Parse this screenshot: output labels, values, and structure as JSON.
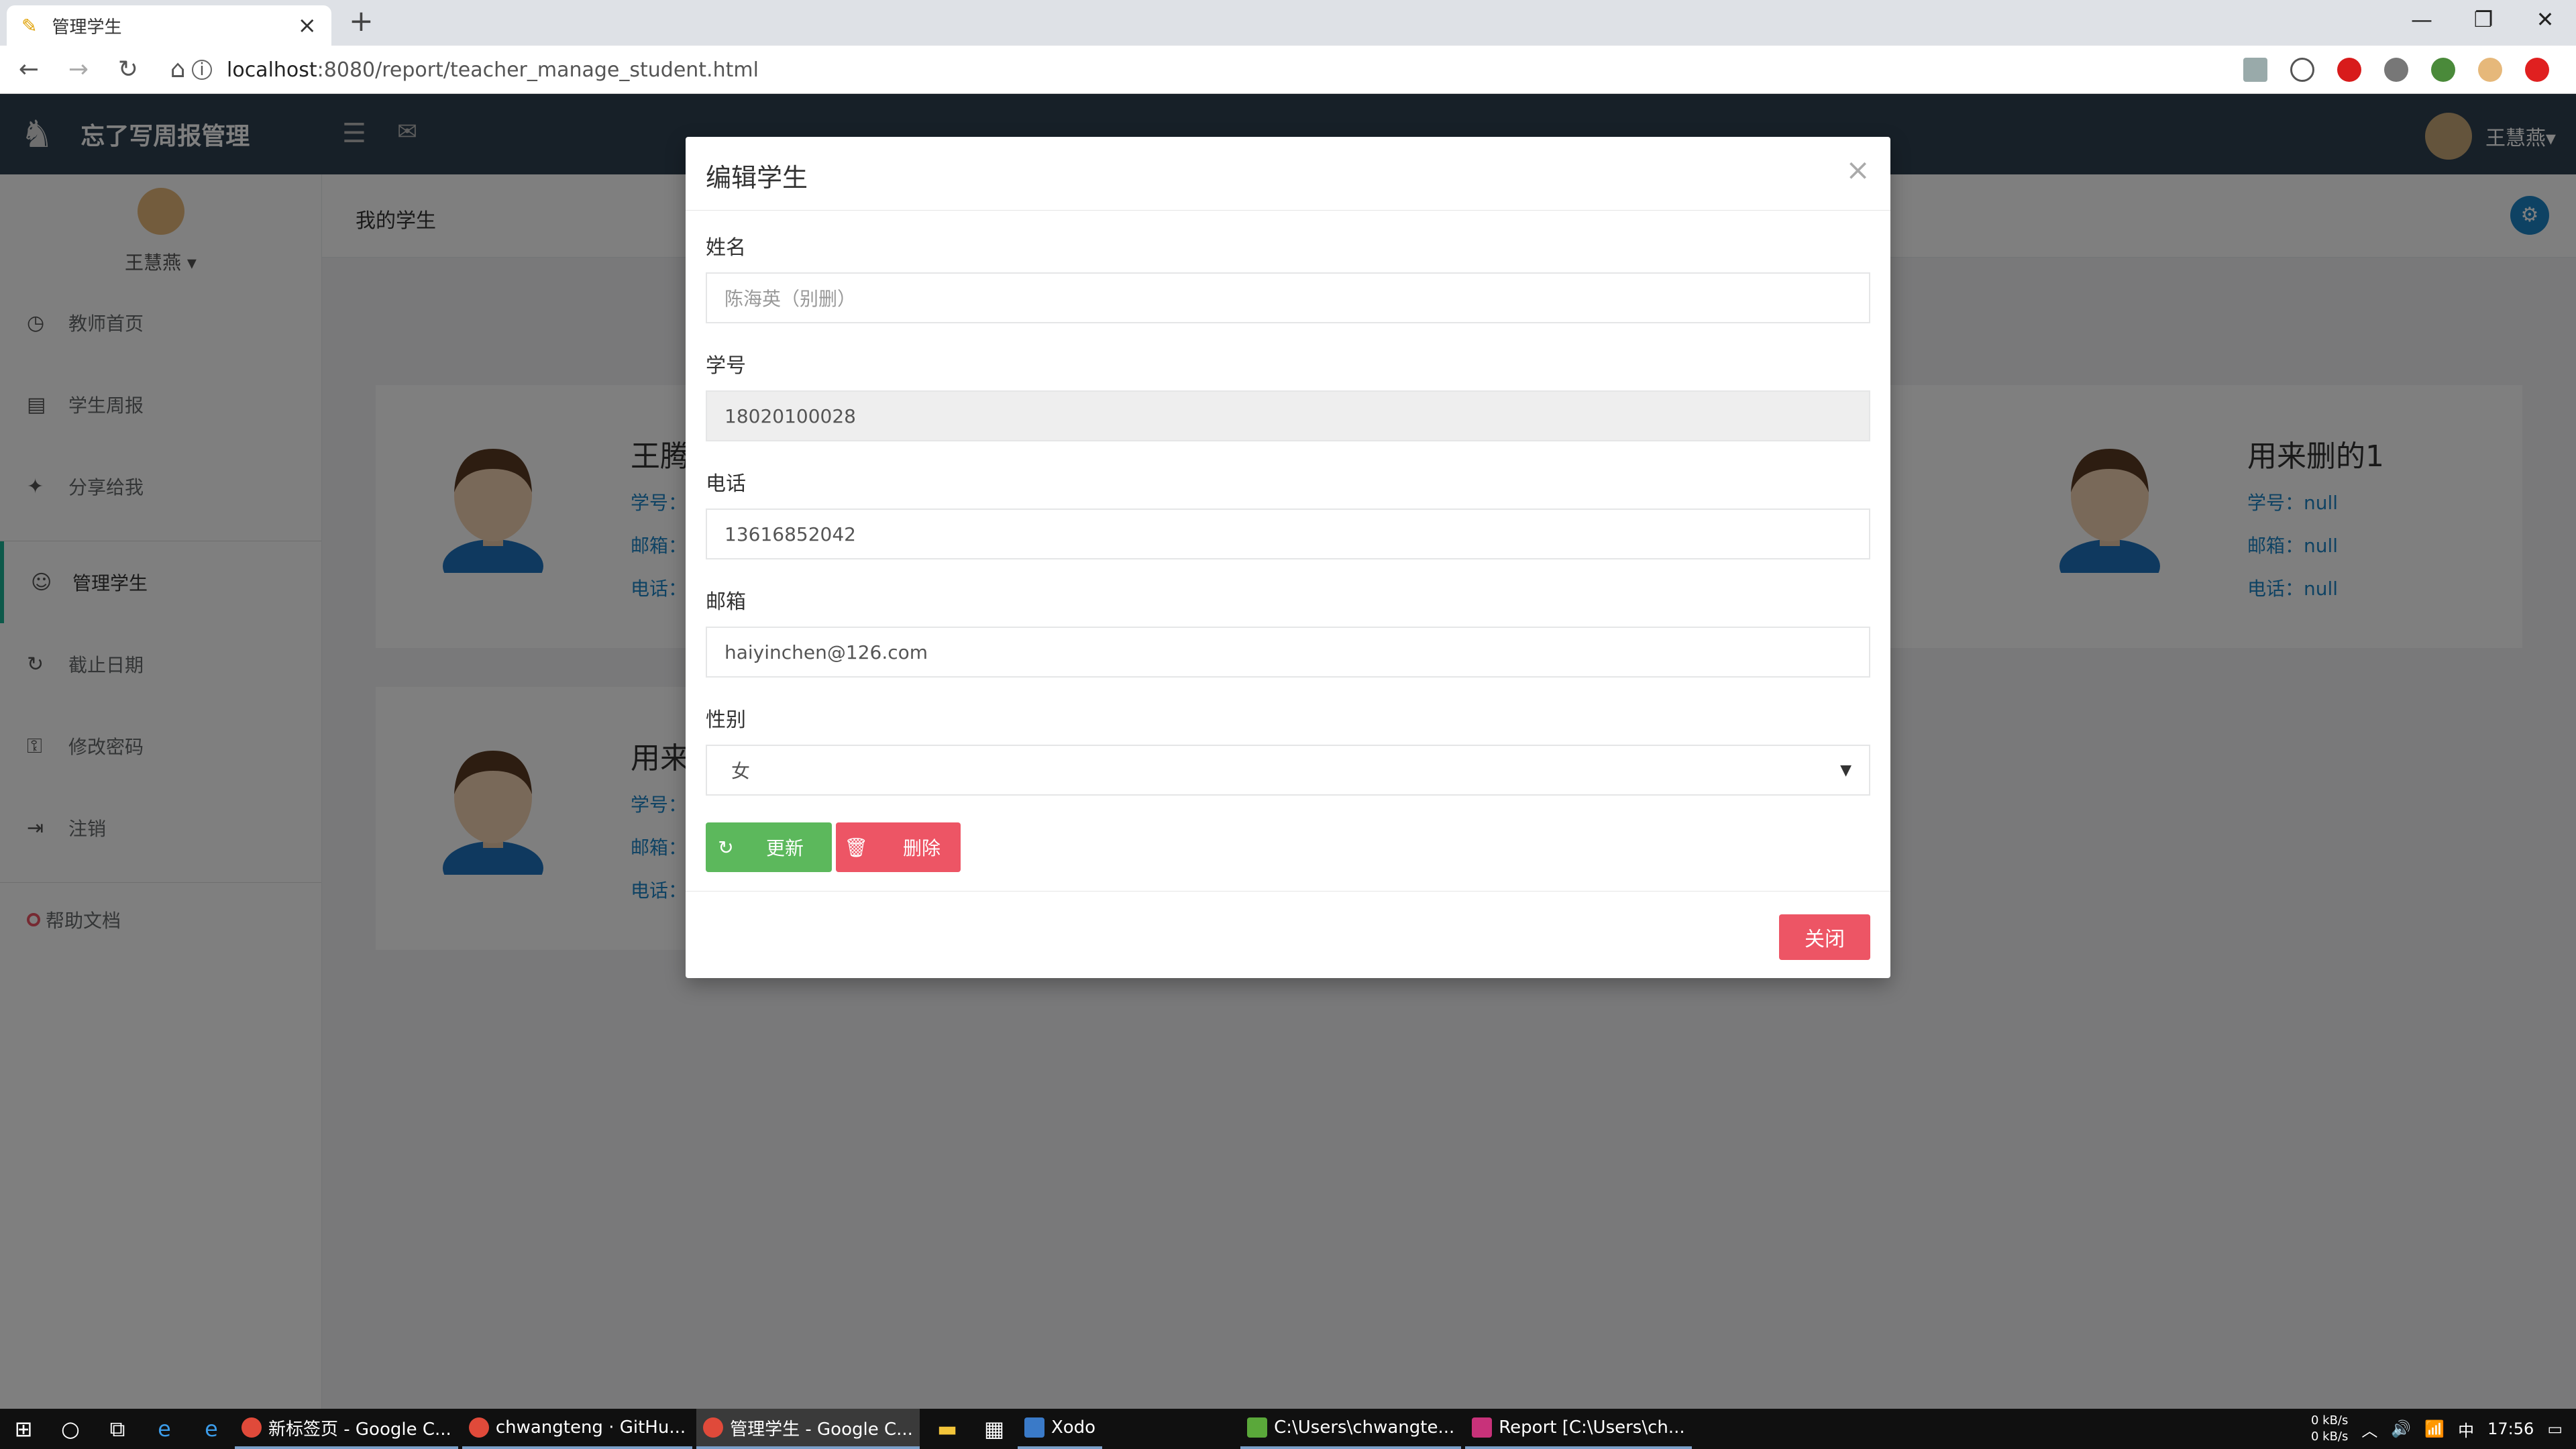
{
  "browser": {
    "tab_title": "管理学生",
    "tab_close": "×",
    "new_tab": "+",
    "url_host": "localhost",
    "url_path": ":8080/report/teacher_manage_student.html",
    "win_min": "—",
    "win_max": "❐",
    "win_close": "✕"
  },
  "app": {
    "brand": "忘了写周报管理",
    "user_name": "王慧燕",
    "top_user": "王慧燕▾",
    "breadcrumb": "我的学生"
  },
  "sidebar": {
    "profile_name": "王慧燕 ▾",
    "items": [
      {
        "label": "教师首页",
        "icon": "◷"
      },
      {
        "label": "学生周报",
        "icon": "▤"
      },
      {
        "label": "分享给我",
        "icon": "✦"
      },
      {
        "label": "管理学生",
        "icon": "☺"
      },
      {
        "label": "截止日期",
        "icon": "↻"
      },
      {
        "label": "修改密码",
        "icon": "⚿"
      },
      {
        "label": "注销",
        "icon": "⇥"
      }
    ],
    "help": "帮助文档"
  },
  "cards": [
    {
      "name": "王腾",
      "sid": "学号：",
      "email": "邮箱：",
      "phone": "电话："
    },
    {
      "name": "用来删的1",
      "sid": "学号：null",
      "email": "邮箱：null",
      "phone": "电话：null"
    },
    {
      "name": "用来",
      "sid": "学号：",
      "email": "邮箱：",
      "phone": "电话："
    }
  ],
  "modal": {
    "title": "编辑学生",
    "close_x": "×",
    "name_label": "姓名",
    "name_placeholder": "陈海英（别删）",
    "sid_label": "学号",
    "sid_value": "18020100028",
    "phone_label": "电话",
    "phone_value": "13616852042",
    "email_label": "邮箱",
    "email_value": "haiyinchen@126.com",
    "gender_label": "性别",
    "gender_value": "女",
    "update_btn": "更新",
    "delete_btn": "删除",
    "close_btn": "关闭"
  },
  "taskbar": {
    "apps": [
      {
        "label": "新标签页 - Google C..."
      },
      {
        "label": "chwangteng · GitHu..."
      },
      {
        "label": "管理学生 - Google C..."
      },
      {
        "label": "Xodo"
      },
      {
        "label": "C:\\Users\\chwangte..."
      },
      {
        "label": "Report [C:\\Users\\ch..."
      }
    ],
    "net_up": "0 kB/s",
    "net_down": "0 kB/s",
    "ime": "中",
    "clock": "17:56"
  },
  "colors": {
    "nav_dark": "#2f4050",
    "accent_green": "#5cb85c",
    "accent_red": "#ed5565",
    "link_blue": "#1c84c6"
  }
}
